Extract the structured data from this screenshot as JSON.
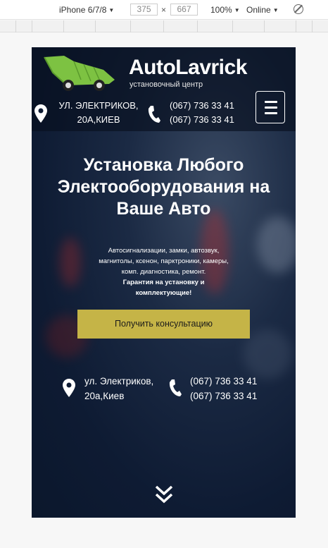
{
  "devtools": {
    "device": "iPhone 6/7/8",
    "width": "375",
    "height": "667",
    "times": "×",
    "zoom": "100%",
    "network": "Online",
    "icons": {
      "caret": "caret-down-icon",
      "rotate": "rotate-icon"
    }
  },
  "site": {
    "logo": {
      "title": "AutoLavrick",
      "subtitle": "установочный центр",
      "colors": {
        "car": "#7dc242"
      }
    },
    "header": {
      "address": [
        "УЛ. ЭЛЕКТРИКОВ,",
        "20А,КИЕВ"
      ],
      "phones": [
        "(067) 736 33 41",
        "(067) 736 33 41"
      ]
    },
    "hero": {
      "title": [
        "Установка Любого",
        "Электооборудования на",
        "Ваше Авто"
      ],
      "description": "Автосигнализации, замки, автозвук, магнитолы, ксенон, парктроники, камеры, комп. диагностика, ремонт.",
      "guarantee": "Гарантия на установку и комплектующие!",
      "cta_label": "Получить консультацию"
    },
    "contacts": {
      "address": [
        "ул. Электриков,",
        "20а,Киев"
      ],
      "phones": [
        "(067) 736 33 41",
        "(067) 736 33 41"
      ]
    },
    "colors": {
      "accent": "#c5b447",
      "header_bg": "#08101e",
      "text": "#ffffff"
    }
  }
}
